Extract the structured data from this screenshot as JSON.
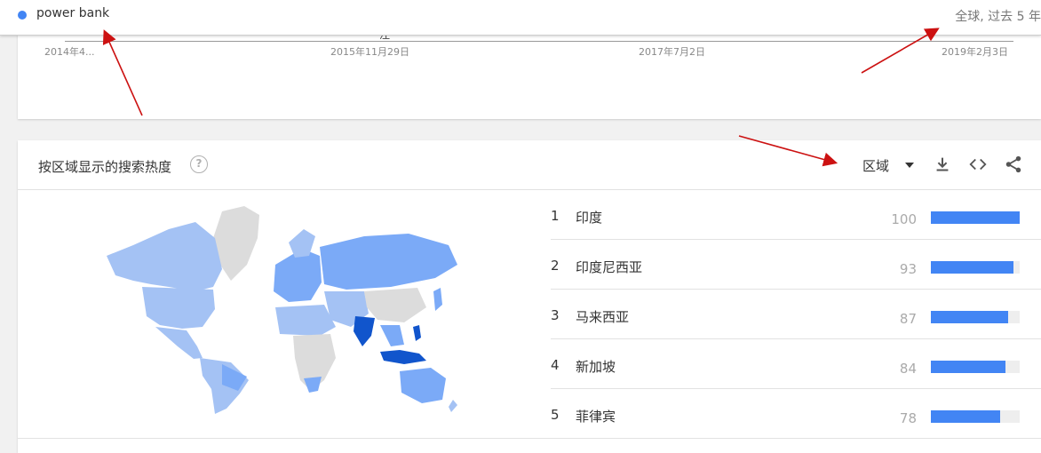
{
  "topbar": {
    "search_term": "power bank",
    "scope": "全球, 过去 5 年",
    "term_color": "#4285f4"
  },
  "timeline": {
    "partial_label": "注",
    "ticks": [
      "2014年4...",
      "2015年11月29日",
      "2017年7月2日",
      "2019年2月3日"
    ]
  },
  "region": {
    "title": "按区域显示的搜索热度",
    "help_icon": "question-circle-icon",
    "resolution_label": "区域",
    "icons": [
      "download-icon",
      "embed-code-icon",
      "share-icon"
    ],
    "rankings": [
      {
        "rank": "1",
        "name": "印度",
        "value": 100
      },
      {
        "rank": "2",
        "name": "印度尼西亚",
        "value": 93
      },
      {
        "rank": "3",
        "name": "马来西亚",
        "value": 87
      },
      {
        "rank": "4",
        "name": "新加坡",
        "value": 84
      },
      {
        "rank": "5",
        "name": "菲律宾",
        "value": 78
      }
    ],
    "map_colors": {
      "none": "#dcdcdc",
      "low": "#a4c2f4",
      "mid": "#7baaf7",
      "high": "#1155cc"
    },
    "bar_color": "#4285f4",
    "annotation_color": "#cc1111"
  }
}
